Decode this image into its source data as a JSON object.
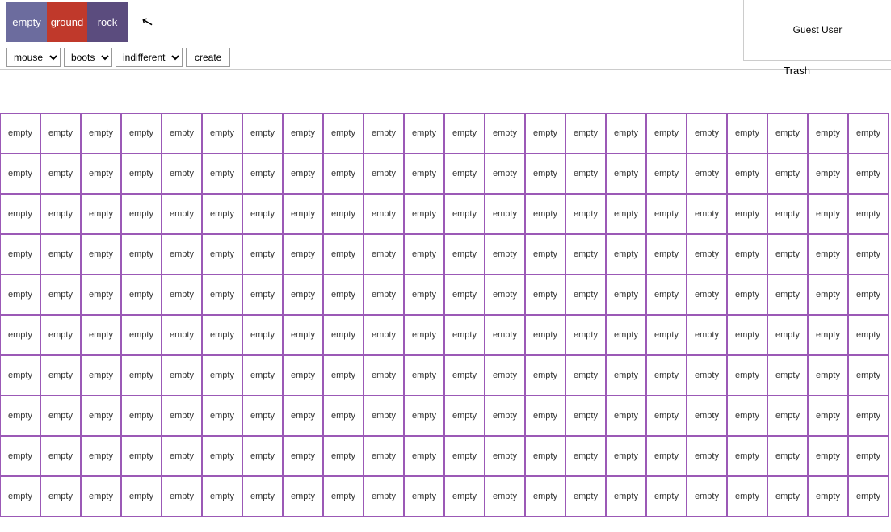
{
  "toolbar": {
    "tiles": [
      {
        "label": "empty",
        "colorClass": "tile-empty"
      },
      {
        "label": "ground",
        "colorClass": "tile-ground"
      },
      {
        "label": "rock",
        "colorClass": "tile-rock"
      }
    ]
  },
  "controls": {
    "mode_options": [
      "mouse"
    ],
    "mode_selected": "mouse",
    "item_options": [
      "boots"
    ],
    "item_selected": "boots",
    "direction_options": [
      "indifferent"
    ],
    "direction_selected": "indifferent",
    "create_label": "create"
  },
  "user": {
    "name": "Guest User"
  },
  "trash_label": "Trash",
  "grid": {
    "cell_label": "empty",
    "rows": 10,
    "cols": 22
  }
}
